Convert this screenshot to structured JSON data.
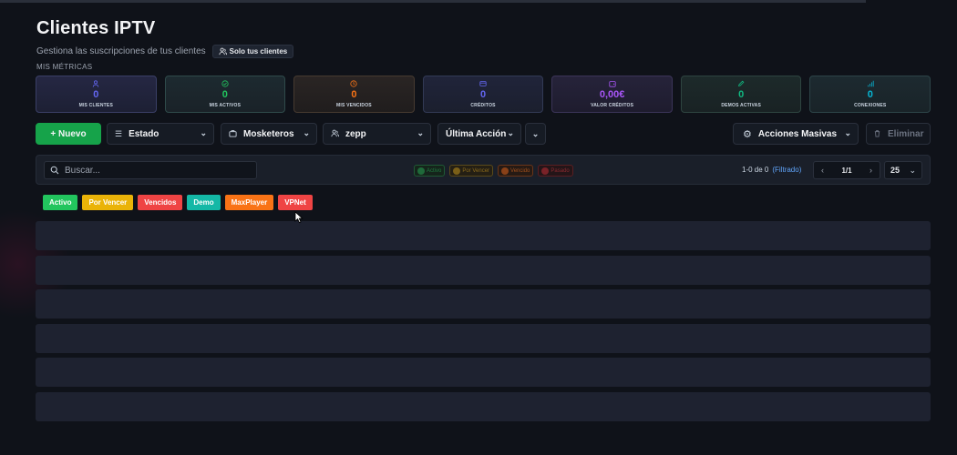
{
  "page": {
    "title": "Clientes IPTV",
    "subtitle": "Gestiona las suscripciones de tus clientes",
    "chip_label": "Solo tus clientes"
  },
  "metrics_label": "MIS MÉTRICAS",
  "metrics": [
    {
      "value": "0",
      "label": "MIS CLIENTES",
      "icon": "user-icon",
      "color": "#6366f1"
    },
    {
      "value": "0",
      "label": "MIS ACTIVOS",
      "icon": "check-circle-icon",
      "color": "#22c55e"
    },
    {
      "value": "0",
      "label": "MIS VENCIDOS",
      "icon": "clock-icon",
      "color": "#f97316"
    },
    {
      "value": "0",
      "label": "CRÉDITOS",
      "icon": "card-icon",
      "color": "#6366f1"
    },
    {
      "value": "0,00€",
      "label": "VALOR CRÉDITOS",
      "icon": "wallet-icon",
      "color": "#a855f7"
    },
    {
      "value": "0",
      "label": "DEMOS ACTIVAS",
      "icon": "pencil-icon",
      "color": "#10b981"
    },
    {
      "value": "0",
      "label": "CONEXIONES",
      "icon": "signal-icon",
      "color": "#06b6d4"
    }
  ],
  "toolbar": {
    "new_label": "+ Nuevo",
    "estado_label": "Estado",
    "mosketeros_label": "Mosketeros",
    "zepp_label": "zepp",
    "ultima_label": "Última Acción",
    "acciones_label": "Acciones Masivas",
    "eliminar_label": "Eliminar"
  },
  "filterbar": {
    "search_placeholder": "Buscar...",
    "legend": [
      "Activo",
      "Por Vencer",
      "Vencido",
      "Pasado"
    ],
    "count": "1-0 de 0",
    "filtered": "(Filtrado)",
    "page": "1/1",
    "per_page": "25"
  },
  "tags": [
    {
      "label": "Activo",
      "color": "#22c55e"
    },
    {
      "label": "Por Vencer",
      "color": "#eab308"
    },
    {
      "label": "Vencidos",
      "color": "#ef4444"
    },
    {
      "label": "Demo",
      "color": "#14b8a6"
    },
    {
      "label": "MaxPlayer",
      "color": "#f97316"
    },
    {
      "label": "VPNet",
      "color": "#ef4444"
    }
  ]
}
